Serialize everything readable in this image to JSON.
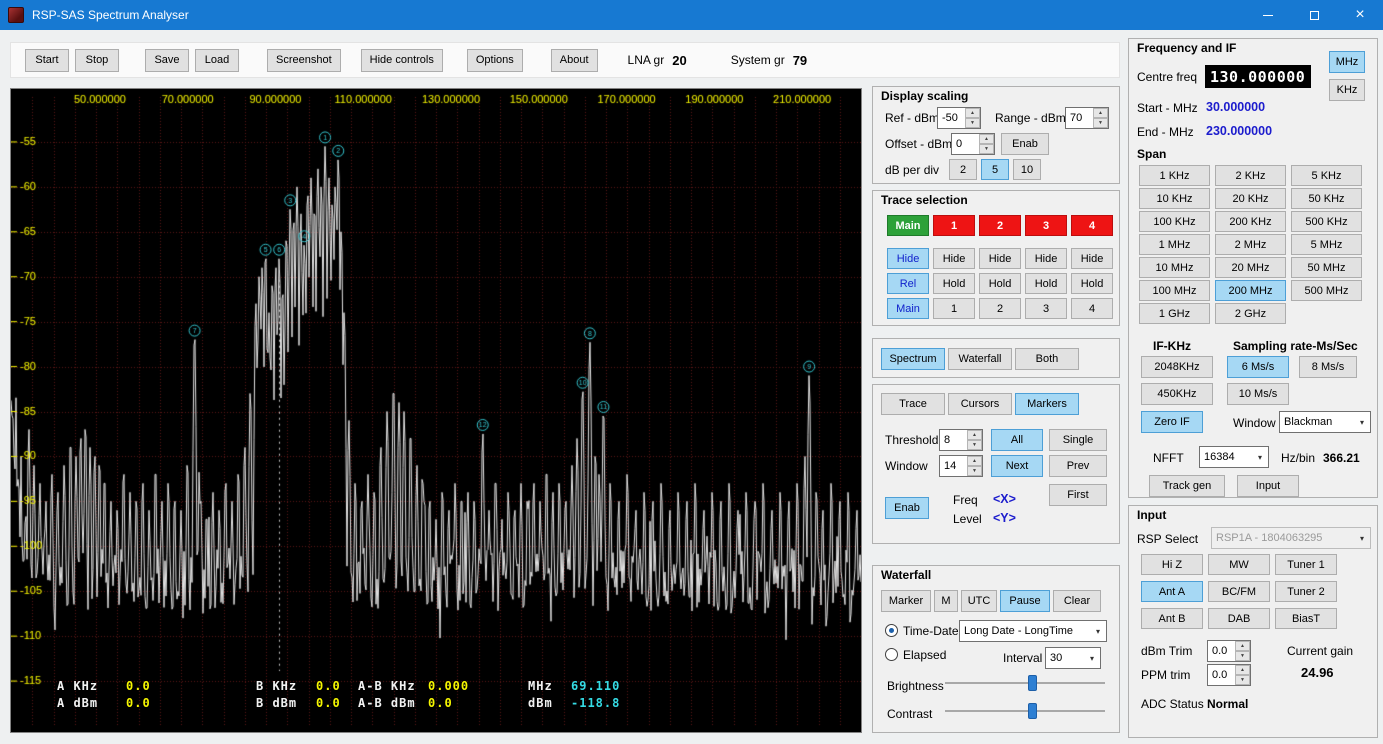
{
  "titlebar": {
    "title": "RSP-SAS Spectrum Analyser"
  },
  "toolbar": {
    "buttons": [
      "Start",
      "Stop",
      "Save",
      "Load",
      "Screenshot",
      "Hide controls",
      "Options",
      "About"
    ],
    "lna_label": "LNA gr",
    "lna_value": "20",
    "system_label": "System gr",
    "system_value": "79"
  },
  "chart_data": {
    "type": "line",
    "freq_start_mhz": 30,
    "freq_end_mhz": 230,
    "ref_dbm": -50,
    "bottom_dbm": -120,
    "db_per_div": 5,
    "noise_floor_dbm": -103,
    "top_labels": [
      "50.000000",
      "70.000000",
      "90.000000",
      "110.000000",
      "130.000000",
      "150.000000",
      "170.000000",
      "190.000000",
      "210.000000"
    ],
    "y_ticks_dbm": [
      -55,
      -60,
      -65,
      -70,
      -75,
      -80,
      -85,
      -90,
      -95,
      -100,
      -105,
      -110,
      -115
    ],
    "grid_color": "#5e1616",
    "label_color": "#f5f500",
    "trace_color": "#e4e4e4",
    "marker_color": "#35c8d2",
    "cursor_line_mhz": 93.1,
    "cursor_line_top_dbm": -69,
    "peaks": [
      [
        34.2,
        -87
      ],
      [
        35.4,
        -91
      ],
      [
        36.8,
        -93
      ],
      [
        38.2,
        -95
      ],
      [
        39.6,
        -92
      ],
      [
        41,
        -94
      ],
      [
        42.5,
        -91
      ],
      [
        44,
        -89
      ],
      [
        45.3,
        -90
      ],
      [
        46.4,
        -88
      ],
      [
        47.5,
        -87
      ],
      [
        48.6,
        -89
      ],
      [
        49.7,
        -90
      ],
      [
        50.8,
        -91
      ],
      [
        52,
        -93
      ],
      [
        53.5,
        -95
      ],
      [
        55,
        -96
      ],
      [
        56.5,
        -92
      ],
      [
        58,
        -94
      ],
      [
        59.5,
        -95
      ],
      [
        61,
        -93
      ],
      [
        62.5,
        -96
      ],
      [
        64,
        -92
      ],
      [
        65.5,
        -95
      ],
      [
        67,
        -93
      ],
      [
        68.5,
        -95
      ],
      [
        70,
        -96
      ],
      [
        71.5,
        -91
      ],
      [
        73.2,
        -77
      ],
      [
        74.6,
        -95
      ],
      [
        76,
        -97
      ],
      [
        77.5,
        -94
      ],
      [
        79,
        -96
      ],
      [
        80.5,
        -93
      ],
      [
        82,
        -95
      ],
      [
        83.5,
        -92
      ],
      [
        85,
        -89
      ],
      [
        86.3,
        -83
      ],
      [
        87.6,
        -73
      ],
      [
        88.4,
        -70
      ],
      [
        89.1,
        -69
      ],
      [
        89.9,
        -68
      ],
      [
        90.7,
        -74
      ],
      [
        91.5,
        -71
      ],
      [
        92.3,
        -69
      ],
      [
        93.1,
        -68
      ],
      [
        93.9,
        -72
      ],
      [
        94.8,
        -66
      ],
      [
        95.7,
        -62.5
      ],
      [
        96.5,
        -64
      ],
      [
        97.3,
        -60
      ],
      [
        98.2,
        -63
      ],
      [
        99,
        -66.5
      ],
      [
        99.8,
        -61
      ],
      [
        100.6,
        -59
      ],
      [
        101.4,
        -63
      ],
      [
        102.2,
        -58
      ],
      [
        103,
        -60
      ],
      [
        103.9,
        -55.5
      ],
      [
        104.8,
        -59
      ],
      [
        105.6,
        -62
      ],
      [
        106.3,
        -60
      ],
      [
        107,
        -57
      ],
      [
        107.7,
        -65
      ],
      [
        108.4,
        -74
      ],
      [
        109.5,
        -86
      ],
      [
        111,
        -93
      ],
      [
        112.5,
        -95
      ],
      [
        114,
        -92
      ],
      [
        115.5,
        -94
      ],
      [
        117,
        -89
      ],
      [
        118.5,
        -85
      ],
      [
        120,
        -83
      ],
      [
        121.3,
        -84
      ],
      [
        122.5,
        -85
      ],
      [
        124,
        -88
      ],
      [
        125.5,
        -91
      ],
      [
        127,
        -93
      ],
      [
        128.5,
        -95
      ],
      [
        130,
        -97
      ],
      [
        131.5,
        -94
      ],
      [
        133,
        -96
      ],
      [
        134.5,
        -93
      ],
      [
        136,
        -95
      ],
      [
        137.5,
        -94
      ],
      [
        139,
        -95
      ],
      [
        141,
        -87.5
      ],
      [
        142.5,
        -96
      ],
      [
        144,
        -93
      ],
      [
        145.5,
        -97
      ],
      [
        147,
        -94
      ],
      [
        148.5,
        -96
      ],
      [
        150,
        -93
      ],
      [
        151.5,
        -95
      ],
      [
        153,
        -93
      ],
      [
        154.5,
        -95
      ],
      [
        156,
        -92
      ],
      [
        157.5,
        -94
      ],
      [
        159,
        -93
      ],
      [
        160.5,
        -95
      ],
      [
        162,
        -91
      ],
      [
        163.2,
        -88
      ],
      [
        164.5,
        -82.8
      ],
      [
        166.2,
        -77.3
      ],
      [
        167.5,
        -90
      ],
      [
        168.4,
        -92
      ],
      [
        169.4,
        -85.5
      ],
      [
        171,
        -93
      ],
      [
        173,
        -95
      ],
      [
        175,
        -92
      ],
      [
        177,
        -96
      ],
      [
        179,
        -94
      ],
      [
        181,
        -95
      ],
      [
        183,
        -93
      ],
      [
        185,
        -96
      ],
      [
        187,
        -94
      ],
      [
        189,
        -95
      ],
      [
        191,
        -93
      ],
      [
        193,
        -96
      ],
      [
        195,
        -94
      ],
      [
        197,
        -95
      ],
      [
        199,
        -93
      ],
      [
        201,
        -96
      ],
      [
        203,
        -94
      ],
      [
        205,
        -95
      ],
      [
        207,
        -93
      ],
      [
        209,
        -96
      ],
      [
        211,
        -94
      ],
      [
        213,
        -95
      ],
      [
        215,
        -93
      ],
      [
        216.8,
        -90
      ],
      [
        217.8,
        -81
      ],
      [
        219.5,
        -94
      ],
      [
        221,
        -96
      ],
      [
        223,
        -93
      ],
      [
        225,
        -95
      ],
      [
        227,
        -94
      ],
      [
        229,
        -96
      ]
    ],
    "markers": [
      {
        "n": 1,
        "f": 103.9,
        "l": -55.5
      },
      {
        "n": 2,
        "f": 107.0,
        "l": -57.0
      },
      {
        "n": 3,
        "f": 95.7,
        "l": -62.5
      },
      {
        "n": 4,
        "f": 99.0,
        "l": -66.5
      },
      {
        "n": 5,
        "f": 89.9,
        "l": -68.0
      },
      {
        "n": 6,
        "f": 93.1,
        "l": -68.0
      },
      {
        "n": 7,
        "f": 73.2,
        "l": -77.0
      },
      {
        "n": 8,
        "f": 166.2,
        "l": -77.3
      },
      {
        "n": 9,
        "f": 217.8,
        "l": -81.0
      },
      {
        "n": 10,
        "f": 164.5,
        "l": -82.8
      },
      {
        "n": 11,
        "f": 169.4,
        "l": -85.5
      },
      {
        "n": 12,
        "f": 141.0,
        "l": -87.5
      }
    ]
  },
  "readout": {
    "a_khz_label": "A KHz",
    "a_khz": "0.0",
    "a_dbm_label": "A dBm",
    "a_dbm": "0.0",
    "b_khz_label": "B KHz",
    "b_khz": "0.0",
    "b_dbm_label": "B dBm",
    "b_dbm": "0.0",
    "ab_khz_label": "A-B KHz",
    "ab_khz": "0.000",
    "ab_dbm_label": "A-B dBm",
    "ab_dbm": "0.0",
    "mhz_label": "MHz",
    "mhz_value": "69.110",
    "dbm_label": "dBm",
    "dbm_value": "-118.8"
  },
  "display_scaling": {
    "title": "Display scaling",
    "ref_label": "Ref - dBm",
    "ref_value": "-50",
    "range_label": "Range - dBm",
    "range_value": "70",
    "offset_label": "Offset - dBm",
    "offset_value": "0",
    "enab_label": "Enab",
    "db_per_div_label": "dB per div",
    "db_options": [
      "2",
      "5",
      "10"
    ],
    "db_selected": "5"
  },
  "trace_selection": {
    "title": "Trace selection",
    "row_traces": [
      "Main",
      "1",
      "2",
      "3",
      "4"
    ],
    "row_hide": [
      "Hide",
      "Hide",
      "Hide",
      "Hide",
      "Hide"
    ],
    "row_hold": [
      "Rel",
      "Hold",
      "Hold",
      "Hold",
      "Hold"
    ],
    "row_select": [
      "Main",
      "1",
      "2",
      "3",
      "4"
    ]
  },
  "view_buttons": {
    "items": [
      "Spectrum",
      "Waterfall",
      "Both"
    ],
    "selected": "Spectrum"
  },
  "mode_buttons": {
    "items": [
      "Trace",
      "Cursors",
      "Markers"
    ],
    "selected": "Markers"
  },
  "markers_panel": {
    "threshold_label": "Threshold",
    "threshold_value": "8",
    "window_label": "Window",
    "window_value": "14",
    "all_label": "All",
    "single_label": "Single",
    "next_label": "Next",
    "prev_label": "Prev",
    "first_label": "First",
    "enab_label": "Enab",
    "freq_label": "Freq",
    "freq_value": "<X>",
    "level_label": "Level",
    "level_value": "<Y>"
  },
  "waterfall": {
    "title": "Waterfall",
    "buttons": [
      "Marker",
      "M",
      "UTC",
      "Pause",
      "Clear"
    ],
    "selected": "Pause",
    "time_date_label": "Time-Date",
    "date_format": "Long Date - LongTime",
    "elapsed_label": "Elapsed",
    "interval_label": "Interval",
    "interval_value": "30",
    "brightness_label": "Brightness",
    "contrast_label": "Contrast",
    "brightness_percent": 55,
    "contrast_percent": 55
  },
  "frequency": {
    "title": "Frequency and IF",
    "centre_label": "Centre freq",
    "centre_value": "130.000000",
    "mhz_label": "MHz",
    "khz_label": "KHz",
    "unit_selected": "MHz",
    "start_label": "Start - MHz",
    "start_value": "30.000000",
    "end_label": "End - MHz",
    "end_value": "230.000000"
  },
  "span": {
    "title": "Span",
    "buttons": [
      "1 KHz",
      "2 KHz",
      "5 KHz",
      "10 KHz",
      "20 KHz",
      "50 KHz",
      "100 KHz",
      "200 KHz",
      "500 KHz",
      "1 MHz",
      "2 MHz",
      "5 MHz",
      "10 MHz",
      "20 MHz",
      "50 MHz",
      "100 MHz",
      "200 MHz",
      "500 MHz",
      "1 GHz",
      "2 GHz"
    ],
    "selected": "200 MHz"
  },
  "if_sampling": {
    "if_label": "IF-KHz",
    "sampling_label": "Sampling rate-Ms/Sec",
    "if_2048": "2048KHz",
    "if_450": "450KHz",
    "sr_6": "6 Ms/s",
    "sr_8": "8 Ms/s",
    "sr_10": "10 Ms/s",
    "sr_selected": "6 Ms/s",
    "zero_if_label": "Zero IF",
    "window_label": "Window",
    "window_value": "Blackman",
    "nfft_label": "NFFT",
    "nfft_value": "16384",
    "hzbin_label": "Hz/bin",
    "hzbin_value": "366.21",
    "track_gen_label": "Track gen",
    "input_label": "Input"
  },
  "input_panel": {
    "title": "Input",
    "rsp_label": "RSP Select",
    "rsp_value": "RSP1A - 1804063295",
    "buttons": [
      "Hi Z",
      "MW",
      "Tuner 1",
      "Ant A",
      "BC/FM",
      "Tuner 2",
      "Ant B",
      "DAB",
      "BiasT"
    ],
    "selected": "Ant A",
    "dbm_trim_label": "dBm Trim",
    "dbm_trim_value": "0.0",
    "ppm_trim_label": "PPM trim",
    "ppm_trim_value": "0.0",
    "current_gain_label": "Current gain",
    "current_gain_value": "24.96",
    "adc_label": "ADC Status",
    "adc_value": "Normal"
  }
}
